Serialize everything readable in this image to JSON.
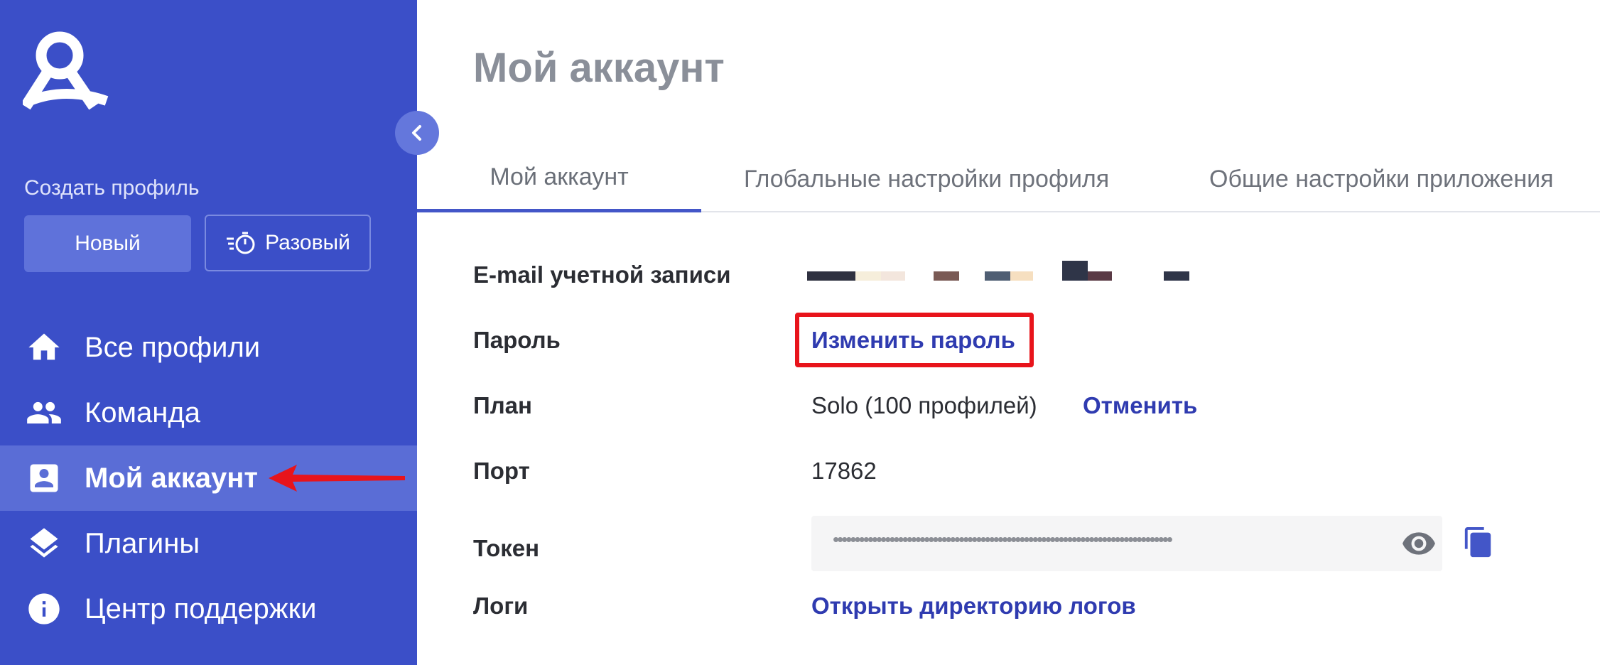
{
  "sidebar": {
    "create_label": "Создать профиль",
    "new_button": "Новый",
    "once_button": "Разовый",
    "items": [
      {
        "label": "Все профили",
        "icon": "home-icon"
      },
      {
        "label": "Команда",
        "icon": "people-icon"
      },
      {
        "label": "Мой аккаунт",
        "icon": "account-icon",
        "active": true
      },
      {
        "label": "Плагины",
        "icon": "layers-icon"
      },
      {
        "label": "Центр поддержки",
        "icon": "info-icon"
      }
    ]
  },
  "main": {
    "title": "Мой аккаунт",
    "tabs": [
      {
        "label": "Мой аккаунт",
        "active": true
      },
      {
        "label": "Глобальные настройки профиля"
      },
      {
        "label": "Общие настройки приложения"
      }
    ],
    "rows": {
      "email_label": "E-mail учетной записи",
      "password_label": "Пароль",
      "password_link": "Изменить пароль",
      "plan_label": "План",
      "plan_value": "Solo (100 профилей)",
      "plan_cancel": "Отменить",
      "port_label": "Порт",
      "port_value": "17862",
      "token_label": "Токен",
      "token_value": "••••••••••••••••••••••••••••••••••••••••••••••••••••••••••••••••••••••••••••••",
      "logs_label": "Логи",
      "logs_link": "Открыть директорию логов"
    }
  },
  "colors": {
    "sidebar_bg": "#3b4fc8",
    "active_item_bg": "#5a6dd6",
    "link": "#2f3bb0",
    "highlight": "#e8141b"
  }
}
